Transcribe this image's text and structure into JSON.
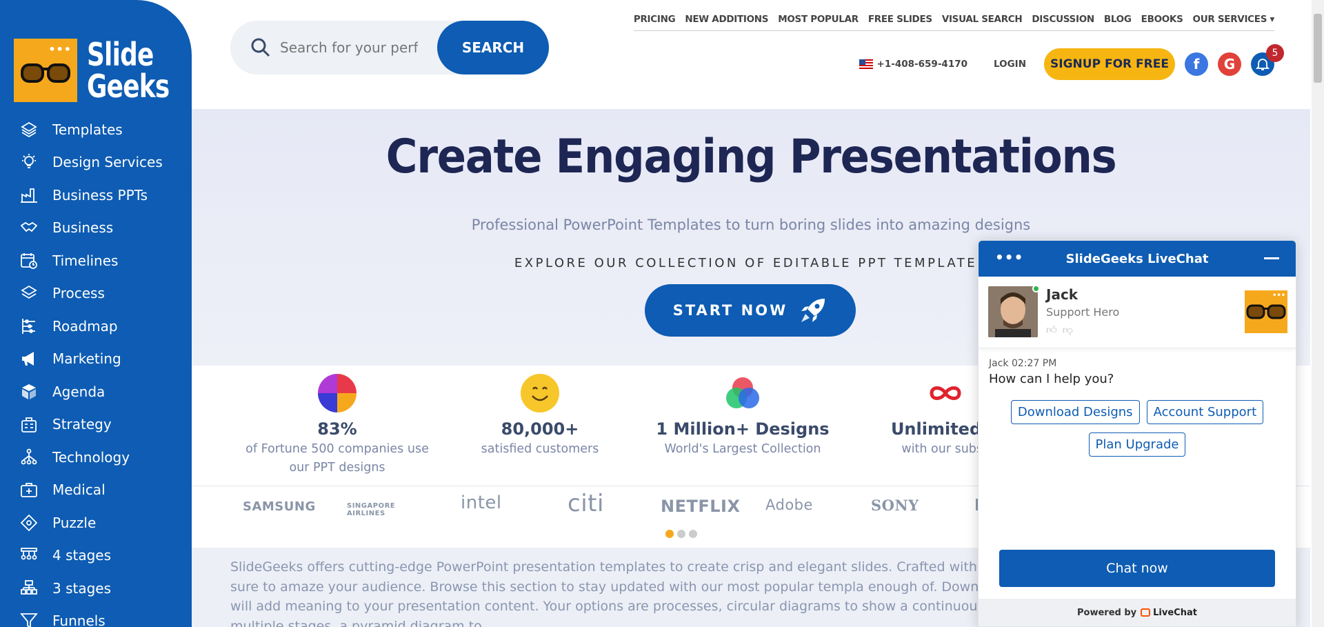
{
  "brand": {
    "name_line1": "Slide",
    "name_line2": "Geeks",
    "logo_dots": "•••"
  },
  "sidebar": {
    "items": [
      {
        "label": "Templates",
        "icon": "layers-icon"
      },
      {
        "label": "Design Services",
        "icon": "lightbulb-icon"
      },
      {
        "label": "Business PPTs",
        "icon": "factory-icon"
      },
      {
        "label": "Business",
        "icon": "handshake-icon"
      },
      {
        "label": "Timelines",
        "icon": "calendar-clock-icon"
      },
      {
        "label": "Process",
        "icon": "layers-icon"
      },
      {
        "label": "Roadmap",
        "icon": "roadmap-icon"
      },
      {
        "label": "Marketing",
        "icon": "megaphone-icon"
      },
      {
        "label": "Agenda",
        "icon": "cube-icon"
      },
      {
        "label": "Strategy",
        "icon": "strategy-icon"
      },
      {
        "label": "Technology",
        "icon": "network-icon"
      },
      {
        "label": "Medical",
        "icon": "medical-kit-icon"
      },
      {
        "label": "Puzzle",
        "icon": "puzzle-icon"
      },
      {
        "label": "4 stages",
        "icon": "stages-icon"
      },
      {
        "label": "3 stages",
        "icon": "stages-icon"
      },
      {
        "label": "Funnels",
        "icon": "funnel-icon"
      }
    ]
  },
  "search": {
    "placeholder": "Search for your perfect presentation",
    "button": "SEARCH"
  },
  "topnav": [
    "PRICING",
    "NEW ADDITIONS",
    "MOST POPULAR",
    "FREE SLIDES",
    "VISUAL SEARCH",
    "DISCUSSION",
    "BLOG",
    "EBOOKS",
    "OUR SERVICES ▾"
  ],
  "header": {
    "phone": "+1-408-659-4170",
    "login": "LOGIN",
    "signup": "SIGNUP FOR FREE",
    "facebook": "f",
    "google": "G",
    "notification_count": "5"
  },
  "hero": {
    "title": "Create Engaging Presentations",
    "subtitle": "Professional PowerPoint Templates to turn boring slides into amazing designs",
    "explore": "EXPLORE OUR COLLECTION OF EDITABLE PPT TEMPLATES",
    "cta": "START NOW"
  },
  "stats": [
    {
      "value": "83%",
      "desc": "of Fortune 500 companies use our PPT designs"
    },
    {
      "value": "80,000+",
      "desc": "satisfied customers"
    },
    {
      "value": "1 Million+ Designs",
      "desc": "World's Largest Collection"
    },
    {
      "value": "Unlimited A",
      "desc": "with our subsc"
    }
  ],
  "client_logos": [
    "SAMSUNG",
    "SINGAPORE AIRLINES",
    "intel",
    "citi",
    "NETFLIX",
    "Adobe",
    "SONY",
    "I"
  ],
  "description": "SlideGeeks offers cutting-edge PowerPoint presentation templates to create crisp and elegant slides. Crafted with precision u content-ready templates are sure to amaze your audience. Browse this section to stay updated with our most popular templa enough of. Download our industry-standard templates that will add meaning to your presentation content. Your options are processes, circular diagrams to show a continuous process, a ladder diagram to show multiple stages, a pyramid diagram to",
  "livechat": {
    "title": "SlideGeeks LiveChat",
    "agent_name": "Jack",
    "agent_role": "Support Hero",
    "message_meta": "Jack 02:27 PM",
    "message": "How can I help you?",
    "chips": [
      "Download Designs",
      "Account Support",
      "Plan Upgrade"
    ],
    "chat_now": "Chat now",
    "powered_by": "Powered by",
    "powered_brand": "LiveChat"
  },
  "colors": {
    "primary": "#0e5cb3",
    "accent": "#f6b511",
    "facebook": "#3b76e1",
    "google": "#e0423a",
    "hero_title": "#1e2654"
  }
}
